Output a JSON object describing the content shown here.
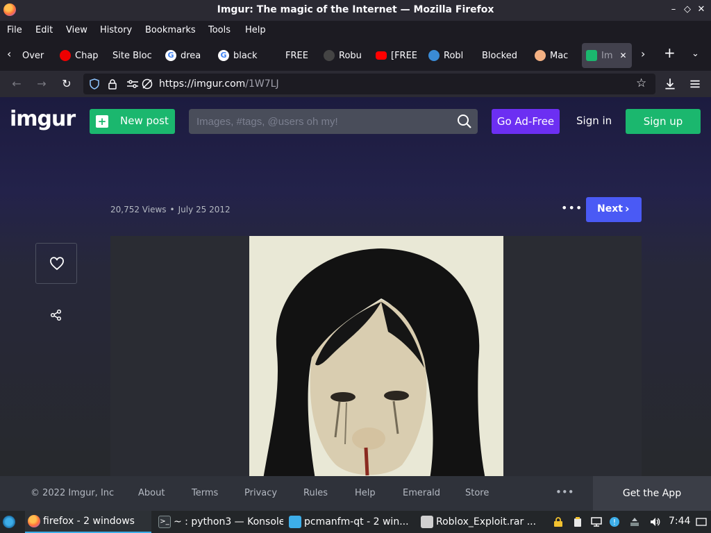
{
  "window": {
    "title": "Imgur: The magic of the Internet — Mozilla Firefox",
    "minimize": "–",
    "maximize": "◇",
    "close": "✕"
  },
  "menu": [
    "File",
    "Edit",
    "View",
    "History",
    "Bookmarks",
    "Tools",
    "Help"
  ],
  "tabs": [
    {
      "label": "Over",
      "icon": "generic-tab-icon",
      "color": "#1c1b22"
    },
    {
      "label": "Chap",
      "icon": "redhat-icon",
      "color": "#ee0000"
    },
    {
      "label": "Site Bloc",
      "icon": "none",
      "color": "#1c1b22"
    },
    {
      "label": "drea",
      "icon": "google-icon",
      "color": "#ffffff"
    },
    {
      "label": "black",
      "icon": "google-icon",
      "color": "#ffffff"
    },
    {
      "label": "FREE",
      "icon": "none",
      "color": "#1c1b22"
    },
    {
      "label": "Robu",
      "icon": "gear-icon",
      "color": "#555555"
    },
    {
      "label": "[FREE",
      "icon": "youtube-icon",
      "color": "#ff0000"
    },
    {
      "label": "Robl",
      "icon": "roblox-icon",
      "color": "#3a8bd6"
    },
    {
      "label": "Blocked",
      "icon": "none",
      "color": "#1c1b22"
    },
    {
      "label": "Mac",
      "icon": "basketball-icon",
      "color": "#f4b183"
    },
    {
      "label": "Im",
      "icon": "imgur-icon",
      "color": "#1bb76e",
      "active": true
    }
  ],
  "url": {
    "host": "https://imgur.com",
    "path": "/1W7LJ"
  },
  "imgur": {
    "logo": "imgur",
    "new_post": "New post",
    "search_placeholder": "Images, #tags, @users oh my!",
    "go_ad_free": "Go Ad-Free",
    "sign_in": "Sign in",
    "sign_up": "Sign up",
    "views": "20,752 Views",
    "separator": "•",
    "date": "July 25 2012",
    "more": "•••",
    "next": "Next",
    "next_chevron": "›",
    "favorite_icon": "heart-icon",
    "share_icon": "share-icon"
  },
  "footer": {
    "copyright": "© 2022 Imgur, Inc",
    "links": [
      "About",
      "Terms",
      "Privacy",
      "Rules",
      "Help",
      "Emerald",
      "Store"
    ],
    "more": "•••",
    "get_app": "Get the App"
  },
  "taskbar": {
    "items": [
      {
        "label": "firefox - 2 windows",
        "icon": "firefox-icon",
        "active": true
      },
      {
        "label": "~ : python3 — Konsole",
        "icon": "terminal-icon"
      },
      {
        "label": "pcmanfm-qt - 2 win...",
        "icon": "folder-icon"
      },
      {
        "label": "Roblox_Exploit.rar ...",
        "icon": "archive-icon"
      }
    ],
    "clock": "7:44"
  },
  "colors": {
    "imgur_green": "#1bb76e",
    "ad_free_purple": "#6c2ff2",
    "next_blue": "#4a5af5",
    "firefox_dark": "#1c1b22"
  }
}
